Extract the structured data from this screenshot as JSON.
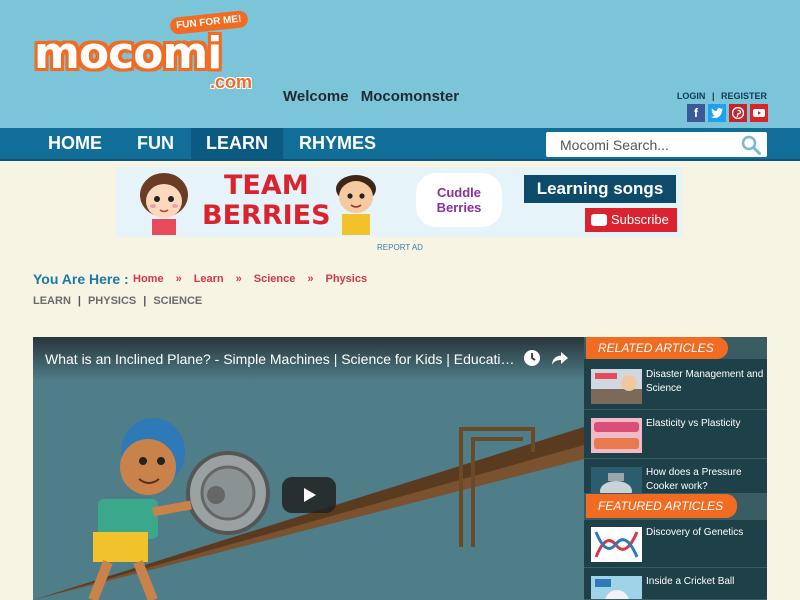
{
  "header": {
    "logo_text": "mocomi",
    "logo_tagline": "FUN FOR ME!",
    "logo_suffix": ".com",
    "welcome_label": "Welcome",
    "username": "Mocomonster",
    "login_label": "LOGIN",
    "separator": "|",
    "register_label": "REGISTER",
    "social_icons": [
      "facebook-icon",
      "twitter-icon",
      "pinterest-icon",
      "youtube-icon"
    ]
  },
  "nav": {
    "items": [
      {
        "label": "HOME",
        "active": false
      },
      {
        "label": "FUN",
        "active": false
      },
      {
        "label": "LEARN",
        "active": true
      },
      {
        "label": "RHYMES",
        "active": false
      }
    ],
    "search_placeholder": "Mocomi Search..."
  },
  "ad": {
    "brand_line1": "TEAM",
    "brand_line2": "BERRIES",
    "cuddle_line1": "Cuddle",
    "cuddle_line2": "Berries",
    "learning_songs": "Learning songs",
    "subscribe": "Subscribe",
    "report_label": "REPORT AD"
  },
  "breadcrumb": {
    "label": "You Are Here :",
    "items": [
      "Home",
      "Learn",
      "Science",
      "Physics"
    ],
    "separator": "»"
  },
  "tags": [
    "LEARN",
    "PHYSICS",
    "SCIENCE"
  ],
  "video": {
    "title": "What is an Inclined Plane? - Simple Machines | Science for Kids | Educational Videos by Mocomi"
  },
  "sidebar": {
    "related_title": "RELATED ARTICLES",
    "related": [
      {
        "label": "Disaster Management and Science"
      },
      {
        "label": "Elasticity vs Plasticity"
      },
      {
        "label": "How does a Pressure Cooker work?"
      }
    ],
    "featured_title": "FEATURED ARTICLES",
    "featured": [
      {
        "label": "Discovery of Genetics"
      },
      {
        "label": "Inside a Cricket Ball"
      }
    ]
  },
  "colors": {
    "header_bg": "#7cc4d8",
    "nav_bg": "#106e99",
    "accent_orange": "#f26b22",
    "crumb_red": "#d2384a",
    "page_bg": "#f7f4e3"
  }
}
